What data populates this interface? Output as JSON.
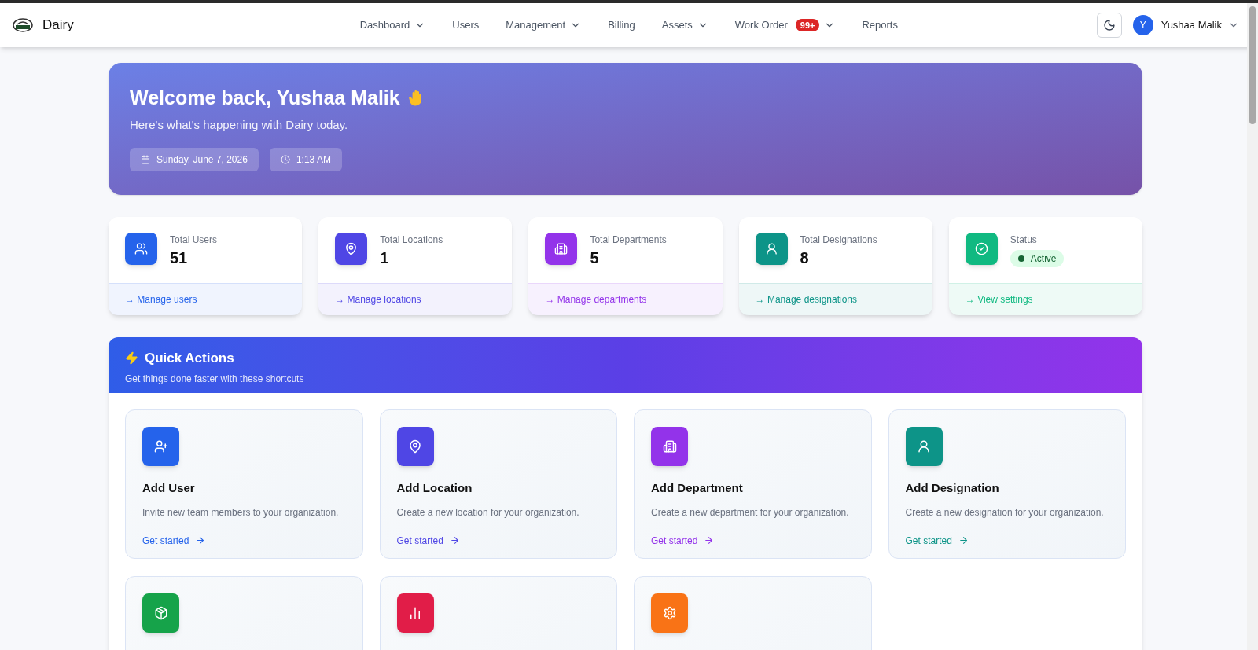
{
  "app": {
    "name": "Dairy"
  },
  "nav": [
    {
      "label": "Dashboard",
      "has_menu": true
    },
    {
      "label": "Users",
      "has_menu": false
    },
    {
      "label": "Management",
      "has_menu": true
    },
    {
      "label": "Billing",
      "has_menu": false
    },
    {
      "label": "Assets",
      "has_menu": true
    },
    {
      "label": "Work Order",
      "has_menu": true,
      "badge": "99+"
    },
    {
      "label": "Reports",
      "has_menu": false
    }
  ],
  "user": {
    "initial": "Y",
    "name": "Yushaa Malik"
  },
  "hero": {
    "title": "Welcome back, Yushaa Malik",
    "subtitle": "Here's what's happening with Dairy today.",
    "date": "Sunday, June 7, 2026",
    "time": "1:13 AM"
  },
  "stats": [
    {
      "label": "Total Users",
      "value": "51",
      "link": "→ Manage users",
      "color": "#2563eb"
    },
    {
      "label": "Total Locations",
      "value": "1",
      "link": "→ Manage locations",
      "color": "#4f46e5"
    },
    {
      "label": "Total Departments",
      "value": "5",
      "link": "→ Manage departments",
      "color": "#9333ea"
    },
    {
      "label": "Total Designations",
      "value": "8",
      "link": "→ Manage designations",
      "color": "#0d9488"
    },
    {
      "label": "Status",
      "badge": "Active",
      "link": "→ View settings",
      "color": "#10b981"
    }
  ],
  "quick_actions": {
    "title": "Quick Actions",
    "subtitle": "Get things done faster with these shortcuts",
    "items": [
      {
        "title": "Add User",
        "description": "Invite new team members to your organization.",
        "link": "Get started",
        "color": "#2563eb"
      },
      {
        "title": "Add Location",
        "description": "Create a new location for your organization.",
        "link": "Get started",
        "color": "#4f46e5"
      },
      {
        "title": "Add Department",
        "description": "Create a new department for your organization.",
        "link": "Get started",
        "color": "#9333ea"
      },
      {
        "title": "Add Designation",
        "description": "Create a new designation for your organization.",
        "link": "Get started",
        "color": "#0d9488"
      },
      {
        "color": "#16a34a"
      },
      {
        "color": "#e11d48"
      },
      {
        "color": "#f97316"
      }
    ]
  }
}
